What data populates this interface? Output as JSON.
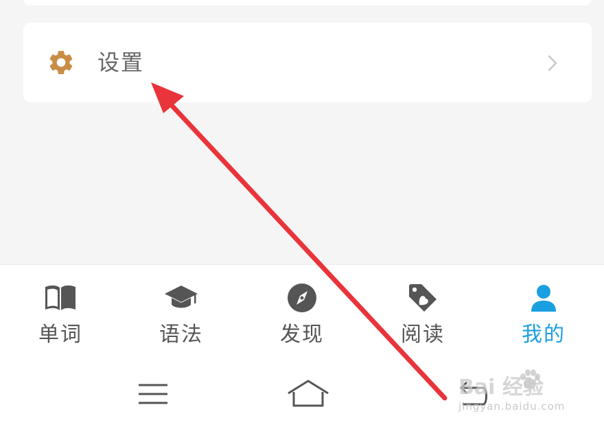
{
  "settings": {
    "label": "设置"
  },
  "tabs": [
    {
      "label": "单词",
      "icon": "book-icon",
      "active": false
    },
    {
      "label": "语法",
      "icon": "graduation-cap-icon",
      "active": false
    },
    {
      "label": "发现",
      "icon": "compass-icon",
      "active": false
    },
    {
      "label": "阅读",
      "icon": "tag-heart-icon",
      "active": false
    },
    {
      "label": "我的",
      "icon": "user-icon",
      "active": true
    }
  ],
  "nav": [
    "menu-icon",
    "home-icon",
    "back-icon"
  ],
  "watermark": {
    "logo": "Bai  经验",
    "sub": "jingyan.baidu.com"
  },
  "colors": {
    "accent": "#1a9fe0",
    "gear": "#c98c45",
    "arrow": "#e8343a"
  }
}
